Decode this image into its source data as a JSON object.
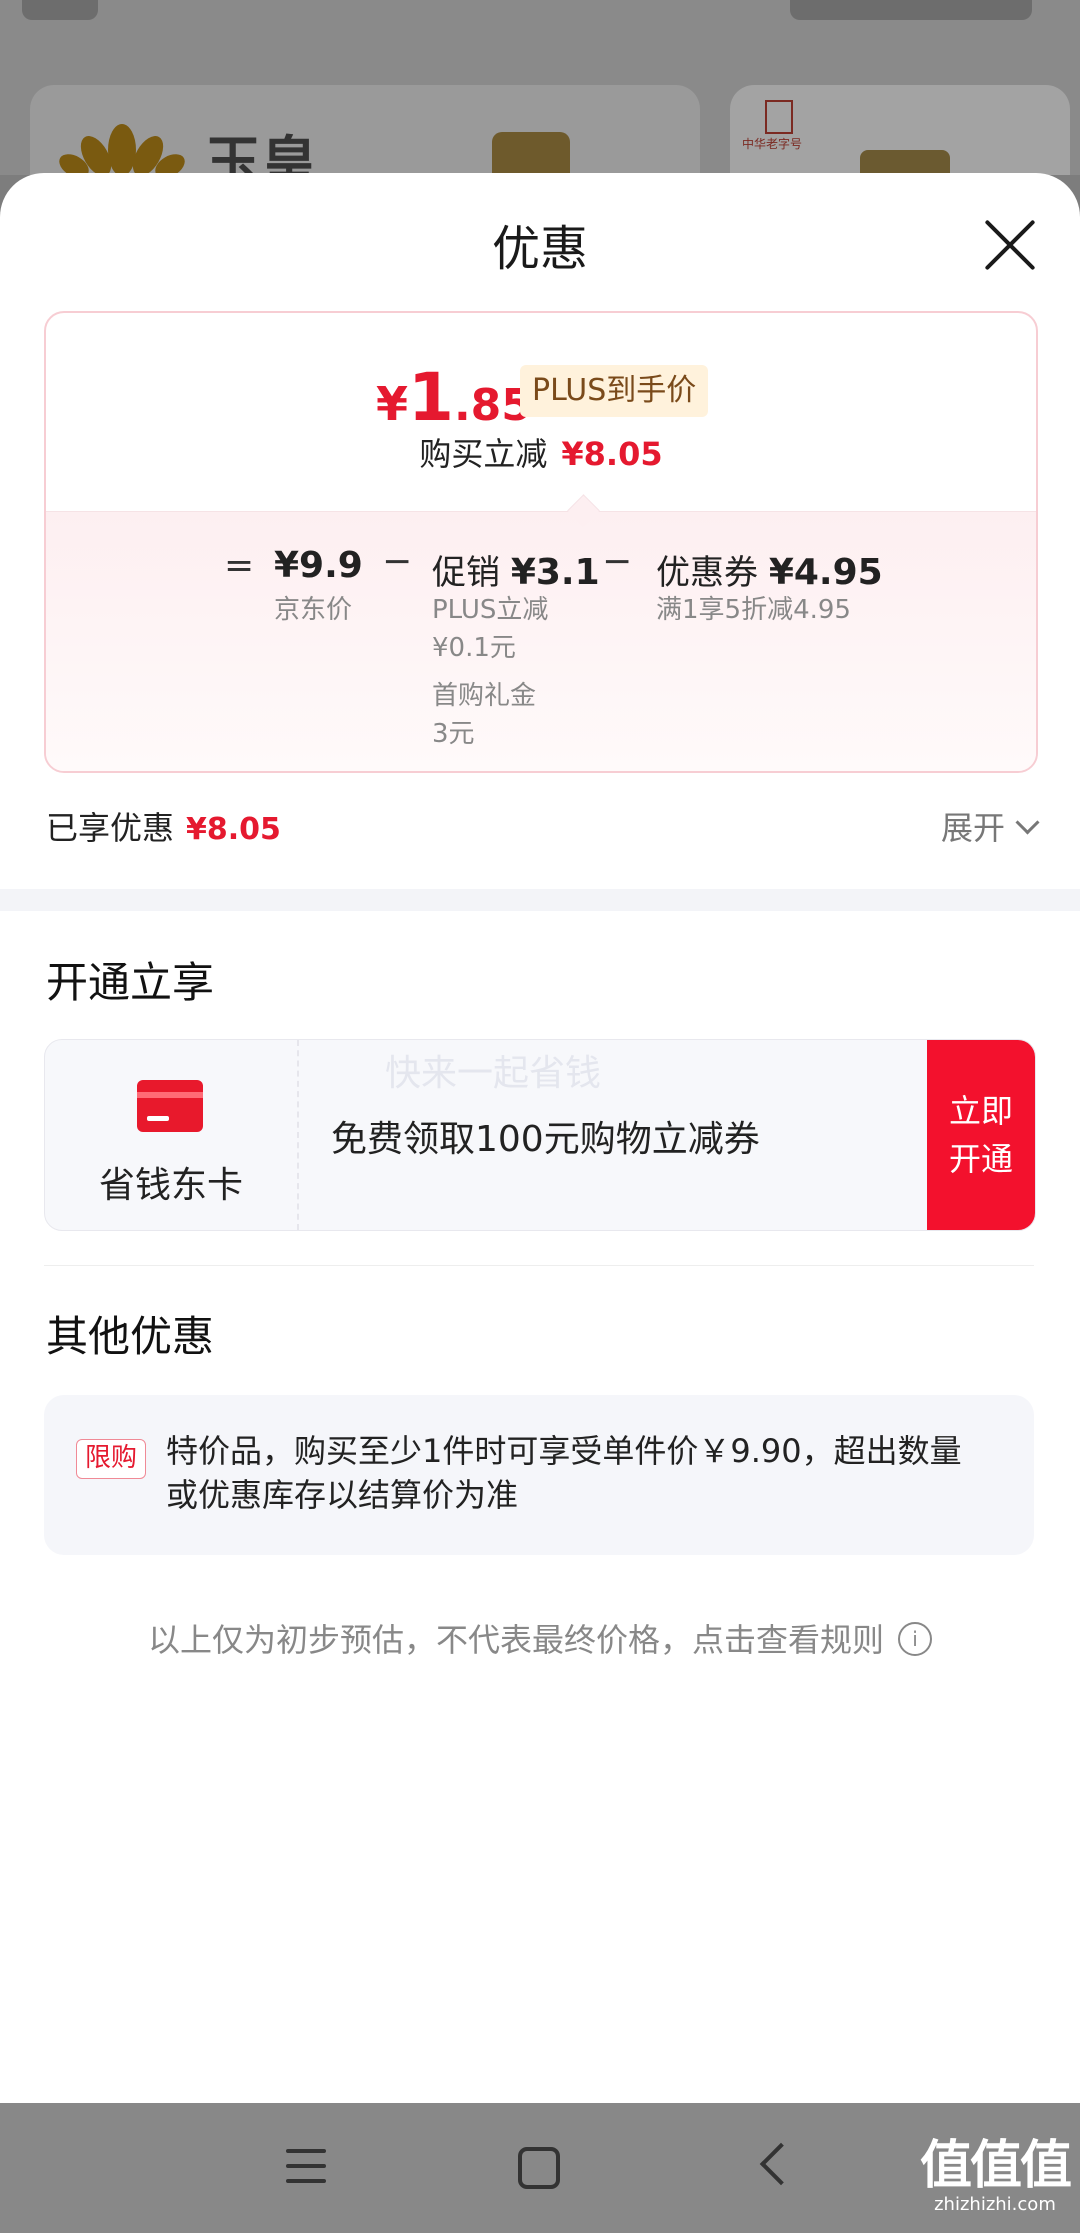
{
  "background": {
    "brand_text": "玉皇",
    "seal_text": "中华老字号"
  },
  "sheet": {
    "title": "优惠",
    "close_icon": "close-icon"
  },
  "price": {
    "currency": "¥",
    "final_int": "1",
    "final_dec": ".85",
    "plus_tag": "PLUS到手价",
    "reduce_label": "购买立减",
    "reduce_amount": "¥8.05"
  },
  "breakdown": {
    "equals": "=",
    "minus": "−",
    "jd_price_value": "¥9.9",
    "jd_price_label": "京东价",
    "promo_label": "促销",
    "promo_value": "¥3.1",
    "promo_detail_1": "PLUS立减",
    "promo_detail_2": "¥0.1元",
    "promo_detail_3": "首购礼金",
    "promo_detail_4": "3元",
    "coupon_label": "优惠券",
    "coupon_value": "¥4.95",
    "coupon_detail": "满1享5折减4.95"
  },
  "enjoyed": {
    "label": "已享优惠",
    "amount": "¥8.05",
    "expand_label": "展开"
  },
  "open_section": {
    "title": "开通立享",
    "card_name": "省钱东卡",
    "watermark": "快来一起省钱",
    "benefit": "免费领取100元购物立减券",
    "button_line1": "立即",
    "button_line2": "开通"
  },
  "other_section": {
    "title": "其他优惠",
    "tag": "限购",
    "text": "特价品，购买至少1件时可享受单件价￥9.90，超出数量或优惠库存以结算价为准"
  },
  "note": {
    "text": "以上仅为初步预估，不代表最终价格，点击查看规则",
    "icon": "i"
  },
  "watermark_site": {
    "chars": "值值值",
    "url": "zhizhizhi.com"
  },
  "colors": {
    "accent": "#e5192f",
    "button": "#f3112d"
  }
}
